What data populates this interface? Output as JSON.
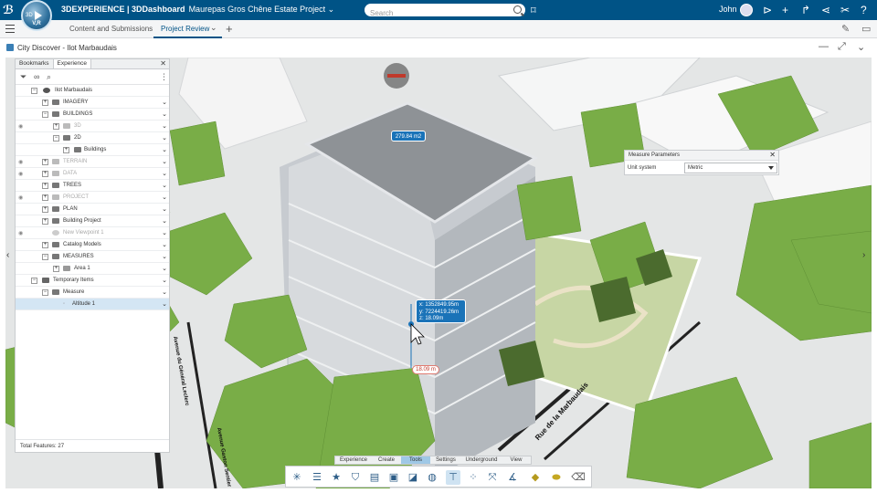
{
  "topbar": {
    "brand": "3DEXPERIENCE | 3DDashboard",
    "project": "Maurepas Gros Chêne Estate Project",
    "compass_label": "3D",
    "compass_version": "V,R",
    "search_placeholder": "Search",
    "user_name": "John"
  },
  "tabs": {
    "items": [
      "Content and Submissions",
      "Project Review"
    ],
    "active": "Project Review"
  },
  "widget": {
    "title": "City Discover - Ilot Marbaudais"
  },
  "panel": {
    "tabs": [
      "Bookmarks",
      "Experience"
    ],
    "active_tab": "Experience",
    "footer": "Total Features: 27",
    "rows": [
      {
        "label": "Ilot Marbaudais",
        "dim": false
      },
      {
        "label": "IMAGERY",
        "dim": false
      },
      {
        "label": "BUILDINGS",
        "dim": false
      },
      {
        "label": "3D",
        "dim": true
      },
      {
        "label": "2D",
        "dim": false
      },
      {
        "label": "Buildings",
        "dim": false
      },
      {
        "label": "TERRAIN",
        "dim": true
      },
      {
        "label": "DATA",
        "dim": true
      },
      {
        "label": "TREES",
        "dim": false
      },
      {
        "label": "PROJECT",
        "dim": true
      },
      {
        "label": "PLAN",
        "dim": false
      },
      {
        "label": "Building Project",
        "dim": false
      },
      {
        "label": "New Viewpoint 1",
        "dim": true
      },
      {
        "label": "Catalog Models",
        "dim": false
      },
      {
        "label": "MEASURES",
        "dim": false
      },
      {
        "label": "Area 1",
        "dim": false
      },
      {
        "label": "Temporary Items",
        "dim": false
      },
      {
        "label": "Measure",
        "dim": false
      },
      {
        "label": "Altitude 1",
        "dim": false
      }
    ]
  },
  "measure_params": {
    "title": "Measure Parameters",
    "unit_label": "Unit system",
    "unit_value": "Metric"
  },
  "viewport": {
    "area_label": "279.84 m2",
    "coord_x": "x: 1352849.95m",
    "coord_y": "y: 7224419.26m",
    "coord_z": "z: 18.09m",
    "distance_label": "18.09 m",
    "street_1": "Rue de la Marbaudais",
    "street_2": "Avenue du Général Leclerc",
    "street_3": "Avenue Gaston Sentier"
  },
  "action_bar": {
    "items": [
      "Experience",
      "Create",
      "Tools",
      "Settings",
      "Underground",
      "View"
    ],
    "active": "Tools"
  },
  "colors": {
    "topbar": "#005386",
    "accent": "#1a73b8",
    "tree": "#7fb24a",
    "building": "#c7cbd0"
  }
}
